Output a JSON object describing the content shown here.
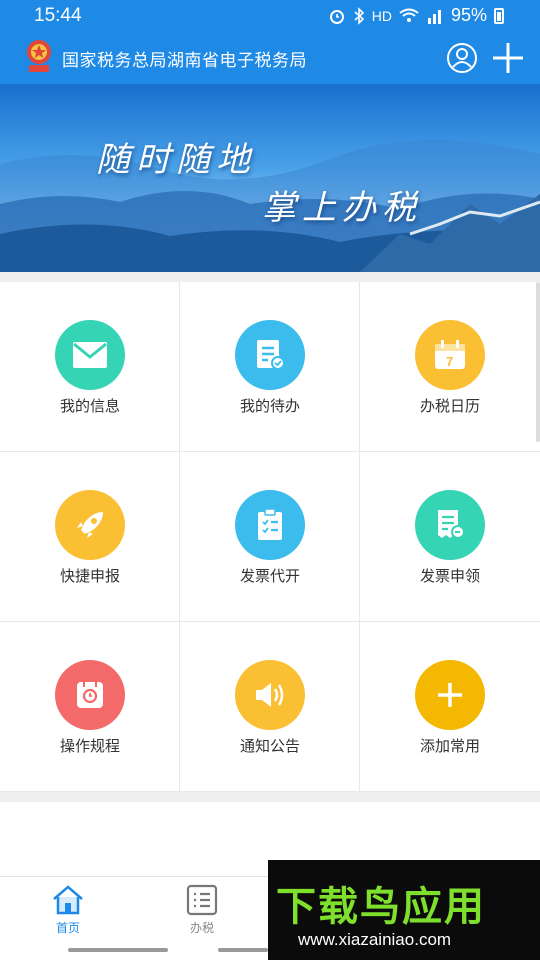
{
  "status_bar": {
    "time": "15:44",
    "network_label": "HD",
    "battery": "95%"
  },
  "header": {
    "title": "国家税务总局湖南省电子税务局",
    "accent_color": "#1f8ae6"
  },
  "banner": {
    "slogan_line1": "随时随地",
    "slogan_line2": "掌上办税"
  },
  "grid": {
    "items": [
      {
        "label": "我的信息",
        "icon": "envelope-icon",
        "color": "#35d4b4"
      },
      {
        "label": "我的待办",
        "icon": "todo-document-icon",
        "color": "#3bbcec"
      },
      {
        "label": "办税日历",
        "icon": "calendar-icon",
        "color": "#fbbf33"
      },
      {
        "label": "快捷申报",
        "icon": "rocket-icon",
        "color": "#fbbf33"
      },
      {
        "label": "发票代开",
        "icon": "clipboard-checklist-icon",
        "color": "#3bbcec"
      },
      {
        "label": "发票申领",
        "icon": "invoice-receipt-icon",
        "color": "#35d4b4"
      },
      {
        "label": "操作规程",
        "icon": "manual-book-icon",
        "color": "#f46a6a"
      },
      {
        "label": "通知公告",
        "icon": "speaker-icon",
        "color": "#fbbf33"
      },
      {
        "label": "添加常用",
        "icon": "plus-icon",
        "color": "#f5b800"
      }
    ]
  },
  "tabbar": {
    "tabs": [
      {
        "label": "首页",
        "icon": "home-icon",
        "active": true
      },
      {
        "label": "办税",
        "icon": "list-icon",
        "active": false
      }
    ]
  },
  "watermark": {
    "brand": "下载鸟应用",
    "url": "www.xiazainiao.com"
  }
}
